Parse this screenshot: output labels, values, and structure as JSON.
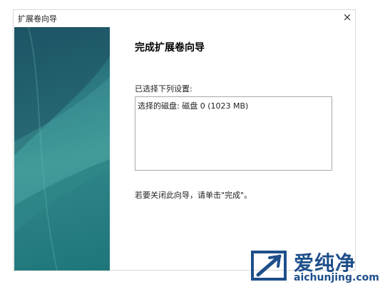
{
  "window": {
    "title": "扩展卷向导",
    "close_symbol": "×"
  },
  "content": {
    "heading": "完成扩展卷向导",
    "settings_label": "已选择下列设置:",
    "settings_text": "选择的磁盘: 磁盘 0 (1023 MB)",
    "close_hint": "若要关闭此向导，请单击\"完成\"。"
  },
  "watermark": {
    "title": "爱纯净",
    "url": "aichunjing.com"
  },
  "icons": {
    "close": "close-icon",
    "logo": "aichunjing-logo-icon"
  },
  "colors": {
    "banner": "#2f7f86",
    "watermark": "#1e4f8a"
  }
}
